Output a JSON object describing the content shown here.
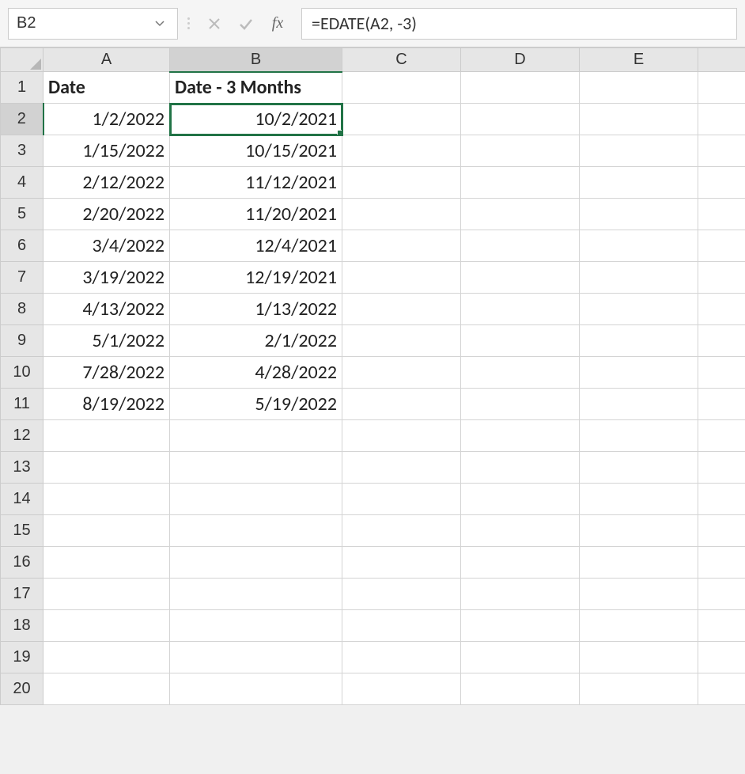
{
  "nameBox": {
    "value": "B2"
  },
  "formulaBar": {
    "value": "=EDATE(A2, -3)",
    "fxLabel": "fx"
  },
  "columnHeaders": [
    "A",
    "B",
    "C",
    "D",
    "E"
  ],
  "activeColumnIndex": 1,
  "activeRowIndex": 1,
  "selectedCell": {
    "col": 1,
    "row": 1
  },
  "rows": [
    {
      "num": "1",
      "cells": [
        {
          "v": "Date",
          "bold": true,
          "align": "left"
        },
        {
          "v": "Date - 3 Months",
          "bold": true,
          "align": "left"
        },
        {
          "v": ""
        },
        {
          "v": ""
        },
        {
          "v": ""
        }
      ]
    },
    {
      "num": "2",
      "cells": [
        {
          "v": "1/2/2022",
          "align": "right"
        },
        {
          "v": "10/2/2021",
          "align": "right"
        },
        {
          "v": ""
        },
        {
          "v": ""
        },
        {
          "v": ""
        }
      ]
    },
    {
      "num": "3",
      "cells": [
        {
          "v": "1/15/2022",
          "align": "right"
        },
        {
          "v": "10/15/2021",
          "align": "right"
        },
        {
          "v": ""
        },
        {
          "v": ""
        },
        {
          "v": ""
        }
      ]
    },
    {
      "num": "4",
      "cells": [
        {
          "v": "2/12/2022",
          "align": "right"
        },
        {
          "v": "11/12/2021",
          "align": "right"
        },
        {
          "v": ""
        },
        {
          "v": ""
        },
        {
          "v": ""
        }
      ]
    },
    {
      "num": "5",
      "cells": [
        {
          "v": "2/20/2022",
          "align": "right"
        },
        {
          "v": "11/20/2021",
          "align": "right"
        },
        {
          "v": ""
        },
        {
          "v": ""
        },
        {
          "v": ""
        }
      ]
    },
    {
      "num": "6",
      "cells": [
        {
          "v": "3/4/2022",
          "align": "right"
        },
        {
          "v": "12/4/2021",
          "align": "right"
        },
        {
          "v": ""
        },
        {
          "v": ""
        },
        {
          "v": ""
        }
      ]
    },
    {
      "num": "7",
      "cells": [
        {
          "v": "3/19/2022",
          "align": "right"
        },
        {
          "v": "12/19/2021",
          "align": "right"
        },
        {
          "v": ""
        },
        {
          "v": ""
        },
        {
          "v": ""
        }
      ]
    },
    {
      "num": "8",
      "cells": [
        {
          "v": "4/13/2022",
          "align": "right"
        },
        {
          "v": "1/13/2022",
          "align": "right"
        },
        {
          "v": ""
        },
        {
          "v": ""
        },
        {
          "v": ""
        }
      ]
    },
    {
      "num": "9",
      "cells": [
        {
          "v": "5/1/2022",
          "align": "right"
        },
        {
          "v": "2/1/2022",
          "align": "right"
        },
        {
          "v": ""
        },
        {
          "v": ""
        },
        {
          "v": ""
        }
      ]
    },
    {
      "num": "10",
      "cells": [
        {
          "v": "7/28/2022",
          "align": "right"
        },
        {
          "v": "4/28/2022",
          "align": "right"
        },
        {
          "v": ""
        },
        {
          "v": ""
        },
        {
          "v": ""
        }
      ]
    },
    {
      "num": "11",
      "cells": [
        {
          "v": "8/19/2022",
          "align": "right"
        },
        {
          "v": "5/19/2022",
          "align": "right"
        },
        {
          "v": ""
        },
        {
          "v": ""
        },
        {
          "v": ""
        }
      ]
    },
    {
      "num": "12",
      "cells": [
        {
          "v": ""
        },
        {
          "v": ""
        },
        {
          "v": ""
        },
        {
          "v": ""
        },
        {
          "v": ""
        }
      ]
    },
    {
      "num": "13",
      "cells": [
        {
          "v": ""
        },
        {
          "v": ""
        },
        {
          "v": ""
        },
        {
          "v": ""
        },
        {
          "v": ""
        }
      ]
    },
    {
      "num": "14",
      "cells": [
        {
          "v": ""
        },
        {
          "v": ""
        },
        {
          "v": ""
        },
        {
          "v": ""
        },
        {
          "v": ""
        }
      ]
    },
    {
      "num": "15",
      "cells": [
        {
          "v": ""
        },
        {
          "v": ""
        },
        {
          "v": ""
        },
        {
          "v": ""
        },
        {
          "v": ""
        }
      ]
    },
    {
      "num": "16",
      "cells": [
        {
          "v": ""
        },
        {
          "v": ""
        },
        {
          "v": ""
        },
        {
          "v": ""
        },
        {
          "v": ""
        }
      ]
    },
    {
      "num": "17",
      "cells": [
        {
          "v": ""
        },
        {
          "v": ""
        },
        {
          "v": ""
        },
        {
          "v": ""
        },
        {
          "v": ""
        }
      ]
    },
    {
      "num": "18",
      "cells": [
        {
          "v": ""
        },
        {
          "v": ""
        },
        {
          "v": ""
        },
        {
          "v": ""
        },
        {
          "v": ""
        }
      ]
    },
    {
      "num": "19",
      "cells": [
        {
          "v": ""
        },
        {
          "v": ""
        },
        {
          "v": ""
        },
        {
          "v": ""
        },
        {
          "v": ""
        }
      ]
    },
    {
      "num": "20",
      "cells": [
        {
          "v": ""
        },
        {
          "v": ""
        },
        {
          "v": ""
        },
        {
          "v": ""
        },
        {
          "v": ""
        }
      ]
    }
  ]
}
